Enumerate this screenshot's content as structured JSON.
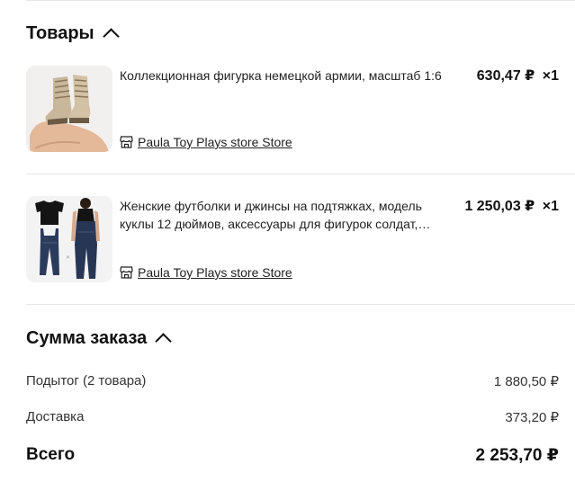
{
  "items_section": {
    "title": "Товары"
  },
  "products": [
    {
      "title": "Коллекционная фигурка немецкой армии, масштаб 1:6",
      "price": "630,47 ₽",
      "qty": "×1",
      "store": "Paula Toy Plays store Store",
      "image_icon": "boots-figure-image"
    },
    {
      "title": "Женские футболки и джинсы на подтяжках, модель куклы 12 дюймов, аксессуары для фигурок солдат, аксессуары для фигурок солдат",
      "price": "1 250,03 ₽",
      "qty": "×1",
      "store": "Paula Toy Plays store Store",
      "image_icon": "overalls-image"
    }
  ],
  "summary": {
    "title": "Сумма заказа",
    "subtotal_label": "Подытог (2 товара)",
    "subtotal_value": "1 880,50 ₽",
    "delivery_label": "Доставка",
    "delivery_value": "373,20 ₽",
    "total_label": "Всего",
    "total_value": "2 253,70 ₽"
  },
  "colors": {
    "text": "#111111",
    "divider": "#e6e6e6",
    "thumb_bg": "#f4f4f4"
  }
}
